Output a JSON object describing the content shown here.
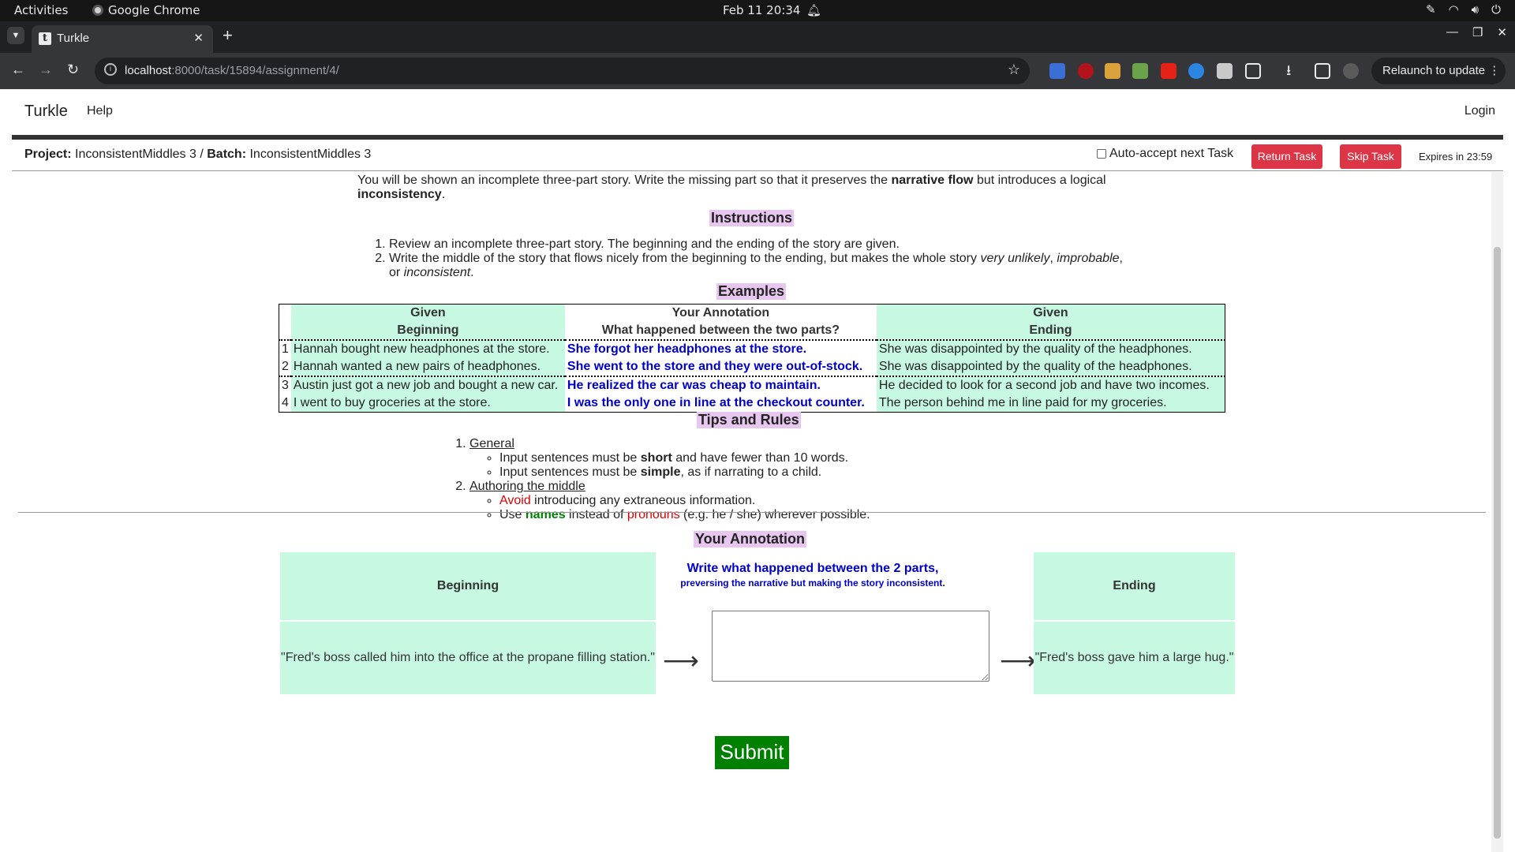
{
  "os": {
    "activities": "Activities",
    "app_name": "Google Chrome",
    "clock": "Feb 11  20:34"
  },
  "browser": {
    "tab_title": "Turkle",
    "url_host": "localhost",
    "url_path": ":8000/task/15894/assignment/4/",
    "relaunch_label": "Relaunch to update"
  },
  "site": {
    "brand": "Turkle",
    "help": "Help",
    "login": "Login"
  },
  "project": {
    "project_label": "Project:",
    "project_name": "InconsistentMiddles 3",
    "batch_label": "Batch:",
    "batch_name": "InconsistentMiddles 3",
    "auto_accept": "Auto-accept next Task",
    "return_task": "Return Task",
    "skip_task": "Skip Task",
    "expires": "Expires in 23:59"
  },
  "intro": {
    "part1": "You will be shown an incomplete three-part story. Write the missing part so that it preserves the ",
    "bold1": "narrative flow",
    "part2": " but introduces a logical ",
    "bold2": "inconsistency",
    "part3": "."
  },
  "instructions": {
    "heading": "Instructions",
    "item1": "Review an incomplete three-part story. The beginning and the ending of the story are given.",
    "item2_a": "Write the middle of the story that flows nicely from the beginning to the ending, but makes the whole story ",
    "item2_i1": "very unlikely",
    "item2_b": ", ",
    "item2_i2": "improbable",
    "item2_c": ", or ",
    "item2_i3": "inconsistent",
    "item2_d": "."
  },
  "examples": {
    "heading": "Examples",
    "col1_top": "Given",
    "col1_bottom": "Beginning",
    "col2_top": "Your Annotation",
    "col2_bottom": "What happened between the two parts?",
    "col3_top": "Given",
    "col3_bottom": "Ending",
    "rows": [
      {
        "n": "1",
        "beginning": "Hannah bought new headphones at the store.",
        "middle": "She forgot her headphones at the store.",
        "ending": "She was disappointed by the quality of the headphones."
      },
      {
        "n": "2",
        "beginning": "Hannah wanted a new pairs of headphones.",
        "middle": "She went to the store and they were out-of-stock.",
        "ending": "She was disappointed by the quality of the headphones."
      },
      {
        "n": "3",
        "beginning": "Austin just got a new job and bought a new car.",
        "middle": "He realized the car was cheap to maintain.",
        "ending": "He decided to look for a second job and have two incomes."
      },
      {
        "n": "4",
        "beginning": "I went to buy groceries at the store.",
        "middle": "I was the only one in line at the checkout counter.",
        "ending": "The person behind me in line paid for my groceries."
      }
    ]
  },
  "tips": {
    "heading": "Tips and Rules",
    "general": "General",
    "g1_a": "Input sentences must be ",
    "g1_b": "short",
    "g1_c": " and have fewer than 10 words.",
    "g2_a": "Input sentences must be ",
    "g2_b": "simple",
    "g2_c": ", as if narrating to a child.",
    "authoring": "Authoring the middle",
    "a1_a": "Avoid",
    "a1_b": " introducing any extraneous information.",
    "a2_a": "Use ",
    "a2_b": "names",
    "a2_c": " instead of ",
    "a2_d": "pronouns",
    "a2_e": " (e.g. he / she) wherever possible."
  },
  "annotation": {
    "heading": "Your Annotation",
    "beginning_header": "Beginning",
    "prompt_main": "Write what happened between the 2 parts,",
    "prompt_small": " preversing the narrative but making the story inconsistent.",
    "ending_header": "Ending",
    "beginning_text": "\"Fred's boss called him into the office at the propane filling station.\"",
    "ending_text": "\"Fred's boss gave him a large hug.\"",
    "arrow": "⟶",
    "answer_value": "",
    "submit": "Submit"
  }
}
